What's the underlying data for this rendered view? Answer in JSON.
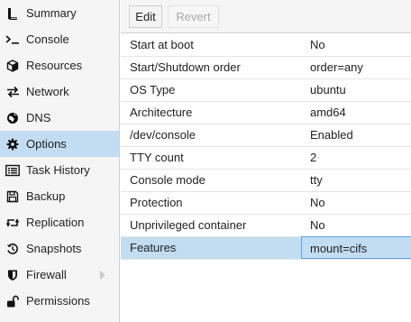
{
  "sidebar": {
    "items": [
      {
        "label": "Summary",
        "icon": "book-icon"
      },
      {
        "label": "Console",
        "icon": "terminal-icon"
      },
      {
        "label": "Resources",
        "icon": "cube-icon"
      },
      {
        "label": "Network",
        "icon": "exchange-icon"
      },
      {
        "label": "DNS",
        "icon": "globe-icon"
      },
      {
        "label": "Options",
        "icon": "gear-icon"
      },
      {
        "label": "Task History",
        "icon": "list-icon"
      },
      {
        "label": "Backup",
        "icon": "floppy-icon"
      },
      {
        "label": "Replication",
        "icon": "retweet-icon"
      },
      {
        "label": "Snapshots",
        "icon": "history-icon"
      },
      {
        "label": "Firewall",
        "icon": "shield-icon"
      },
      {
        "label": "Permissions",
        "icon": "unlock-icon"
      }
    ],
    "active_item": "Options"
  },
  "toolbar": {
    "edit_label": "Edit",
    "revert_label": "Revert"
  },
  "options": {
    "rows": [
      {
        "key": "Start at boot",
        "value": "No"
      },
      {
        "key": "Start/Shutdown order",
        "value": "order=any"
      },
      {
        "key": "OS Type",
        "value": "ubuntu"
      },
      {
        "key": "Architecture",
        "value": "amd64"
      },
      {
        "key": "/dev/console",
        "value": "Enabled"
      },
      {
        "key": "TTY count",
        "value": "2"
      },
      {
        "key": "Console mode",
        "value": "tty"
      },
      {
        "key": "Protection",
        "value": "No"
      },
      {
        "key": "Unprivileged container",
        "value": "No"
      },
      {
        "key": "Features",
        "value": "mount=cifs"
      }
    ],
    "selected_row": "Features"
  },
  "colors": {
    "selection": "#c2ddf2",
    "selection_border": "#5fa2dd",
    "sidebar_bg": "#f5f5f5"
  }
}
